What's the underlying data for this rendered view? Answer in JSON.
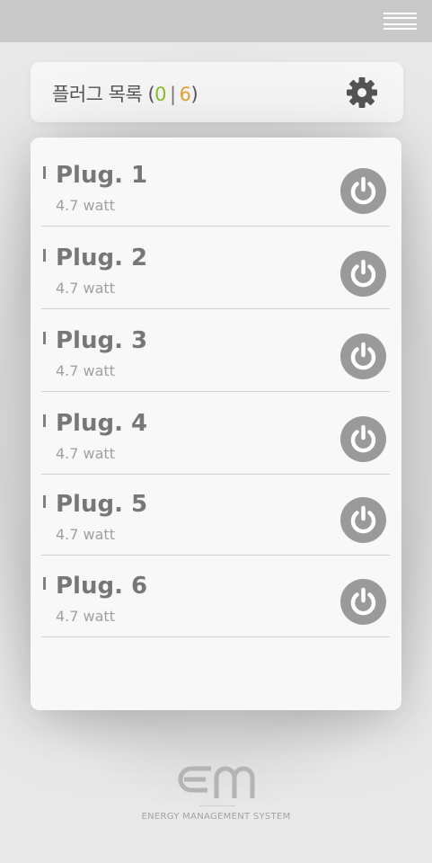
{
  "header": {
    "title": "플러그 목록",
    "count_open": " (",
    "count_on": "0",
    "count_separator": "|",
    "count_total": "6",
    "count_close": ")",
    "settings_icon": "gear-icon",
    "menu_icon": "hamburger-menu-icon"
  },
  "colors": {
    "count_on": "#8cbf26",
    "count_total": "#e8a234",
    "power_icon_bg": "#9a9a9a"
  },
  "plugs": [
    {
      "name": "Plug. 1",
      "power": "4.7 watt",
      "icon": "power-icon"
    },
    {
      "name": "Plug. 2",
      "power": "4.7 watt",
      "icon": "power-icon"
    },
    {
      "name": "Plug. 3",
      "power": "4.7 watt",
      "icon": "power-icon"
    },
    {
      "name": "Plug. 4",
      "power": "4.7 watt",
      "icon": "power-icon"
    },
    {
      "name": "Plug. 5",
      "power": "4.7 watt",
      "icon": "power-icon"
    },
    {
      "name": "Plug. 6",
      "power": "4.7 watt",
      "icon": "power-icon"
    }
  ],
  "footer": {
    "logo": "em-logo",
    "tagline": "ENERGY MANAGEMENT SYSTEM"
  }
}
